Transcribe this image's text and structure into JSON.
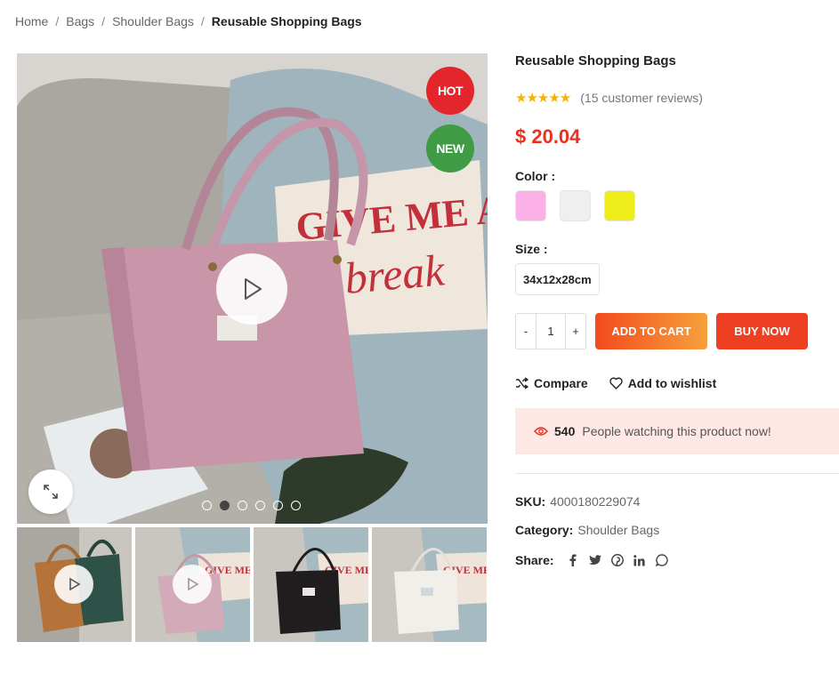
{
  "breadcrumb": {
    "items": [
      "Home",
      "Bags",
      "Shoulder Bags"
    ],
    "separator": "/",
    "current": "Reusable Shopping Bags"
  },
  "gallery": {
    "badges": {
      "hot": "HOT",
      "new": "NEW"
    },
    "slide_count": 6,
    "active_slide": 1
  },
  "product": {
    "title": "Reusable Shopping Bags",
    "rating": 5,
    "reviews_text": "(15 customer reviews)",
    "price": "$ 20.04",
    "color_label": "Color :",
    "colors": [
      "#fbb0e8",
      "#efefef",
      "#eded1b"
    ],
    "size_label": "Size :",
    "size_option": "34x12x28cm",
    "quantity": {
      "minus": "-",
      "value": "1",
      "plus": "+"
    },
    "add_to_cart": "ADD TO CART",
    "buy_now": "BUY NOW",
    "compare": "Compare",
    "wishlist": "Add to wishlist",
    "watching_count": "540",
    "watching_text": "People watching this product now!",
    "sku_label": "SKU:",
    "sku": "4000180229074",
    "category_label": "Category:",
    "category": "Shoulder Bags",
    "share_label": "Share:"
  },
  "icons": {
    "share": [
      "facebook-icon",
      "twitter-icon",
      "pinterest-icon",
      "linkedin-icon",
      "whatsapp-icon"
    ]
  },
  "colors": {
    "accent": "#e8311e",
    "hot": "#e3262c",
    "new": "#3f9b44",
    "star": "#f5b301",
    "watch_bg": "#fde8e5"
  }
}
